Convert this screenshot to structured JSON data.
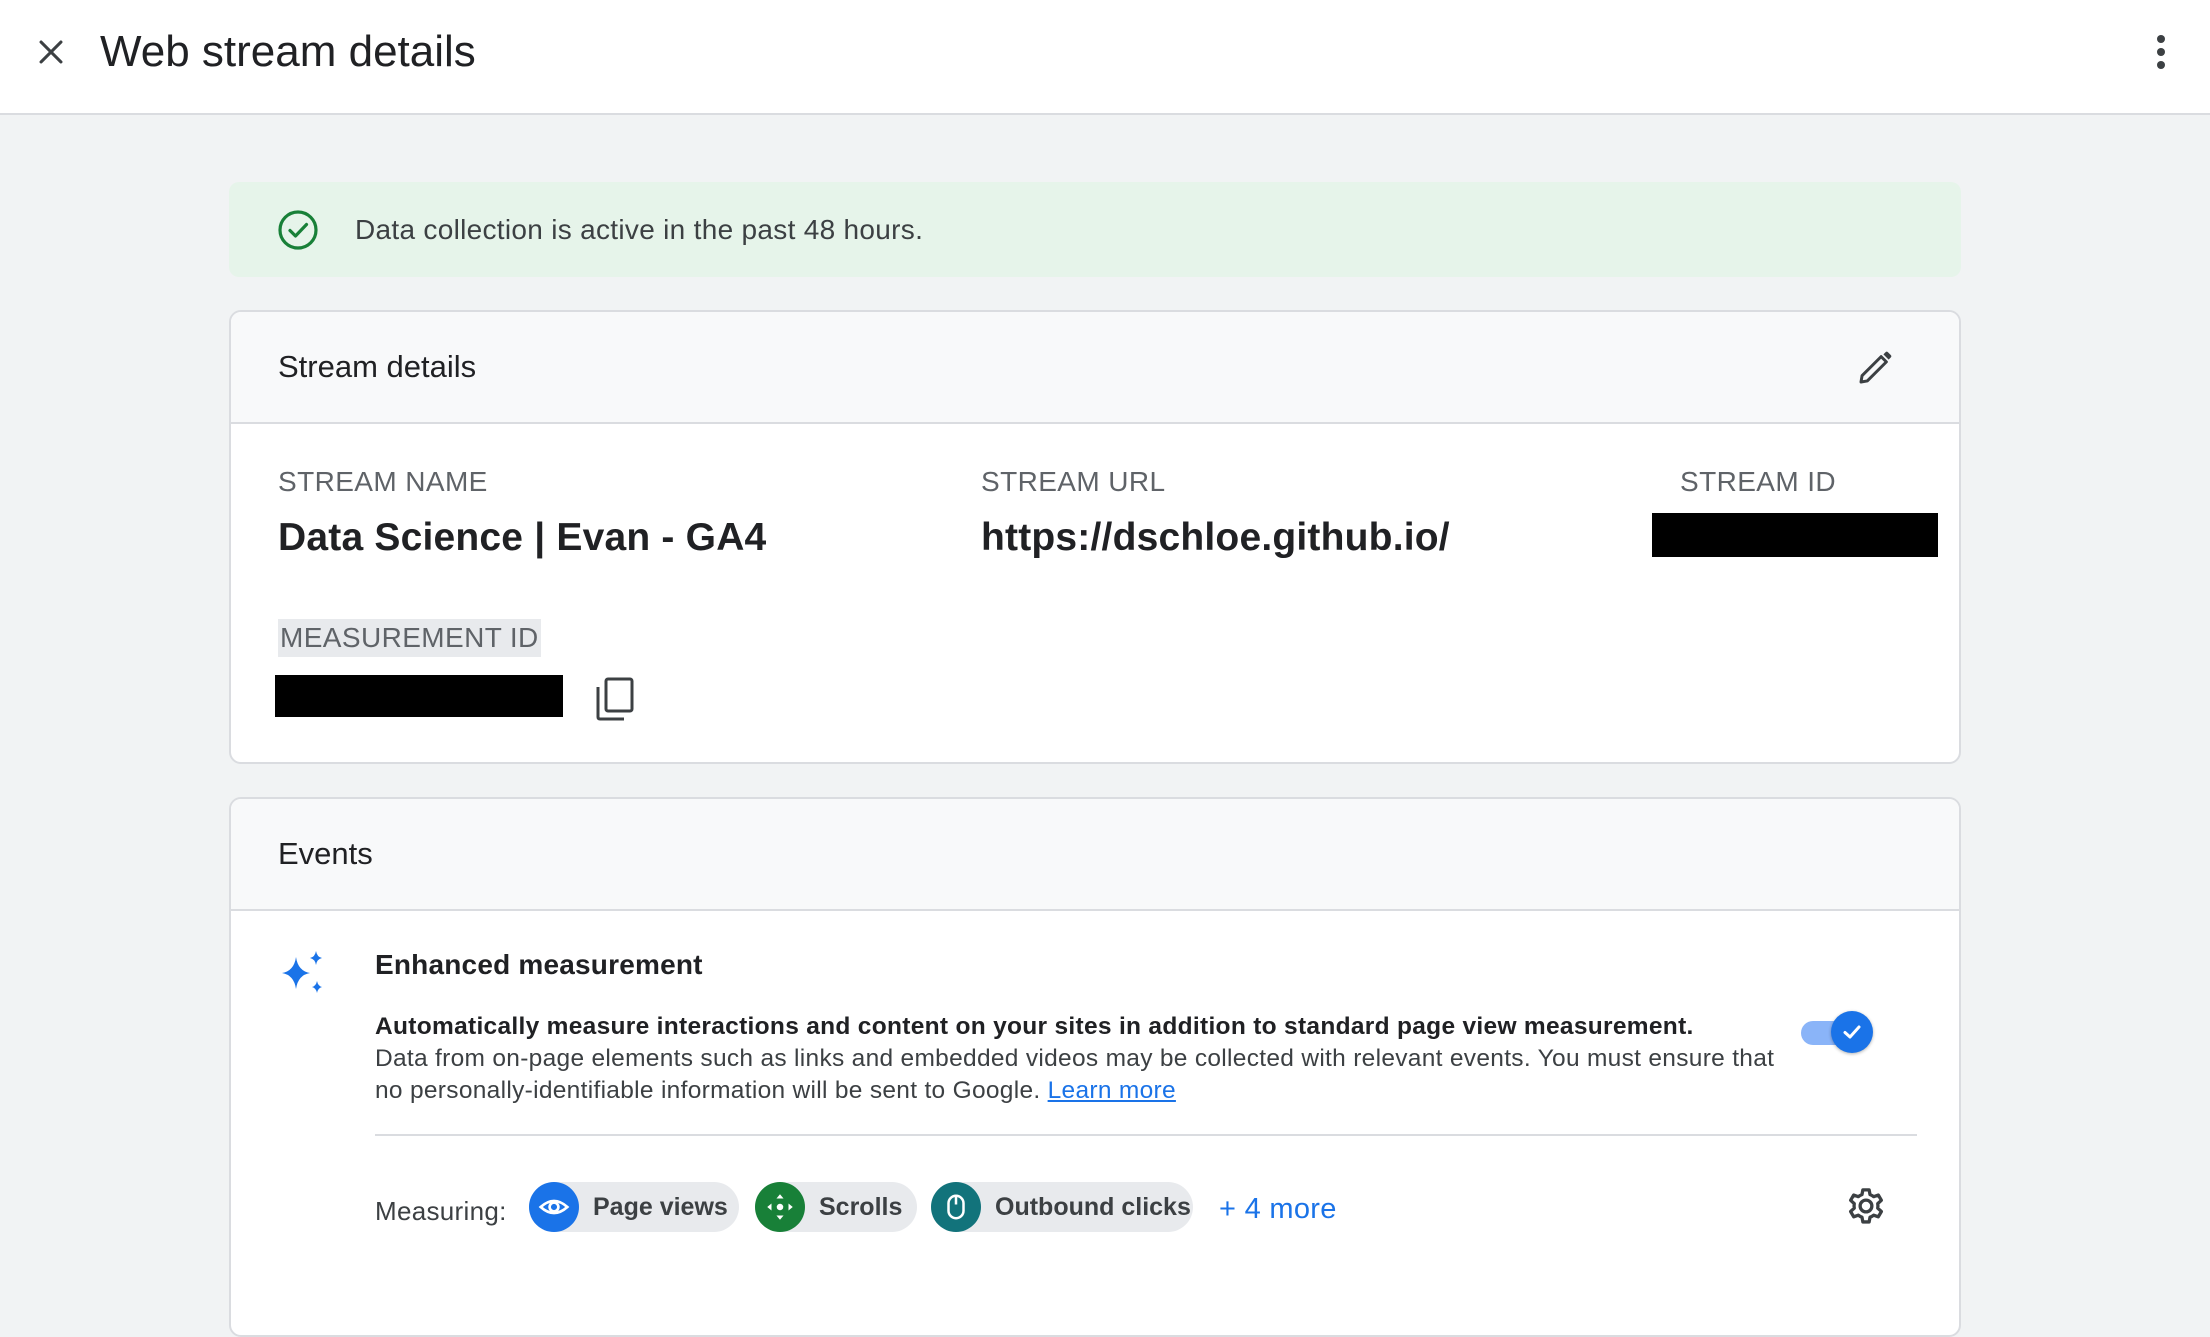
{
  "header": {
    "title": "Web stream details",
    "close_icon": "close-icon",
    "more_icon": "more-vert-icon"
  },
  "status_banner": {
    "text": "Data collection is active in the past 48 hours.",
    "icon": "check-circle-icon",
    "color": "#188038"
  },
  "stream_details": {
    "heading": "Stream details",
    "edit_icon": "pencil-icon",
    "stream_name_label": "STREAM NAME",
    "stream_name_value": "Data Science | Evan - GA4",
    "stream_url_label": "STREAM URL",
    "stream_url_value": "https://dschloe.github.io/",
    "stream_id_label": "STREAM ID",
    "measurement_id_label": "MEASUREMENT ID",
    "copy_icon": "copy-icon"
  },
  "events": {
    "heading": "Events",
    "enhanced": {
      "icon": "sparkle-icon",
      "title": "Enhanced measurement",
      "desc_strong": "Automatically measure interactions and content on your sites in addition to standard page view measurement.",
      "desc_rest": "Data from on-page elements such as links and embedded videos may be collected with relevant events. You must ensure that no personally-identifiable information will be sent to Google.",
      "learn_more": "Learn more",
      "toggle_on": true
    },
    "measuring_label": "Measuring:",
    "chips": [
      {
        "label": "Page views",
        "icon": "eye-icon",
        "color": "#1a73e8"
      },
      {
        "label": "Scrolls",
        "icon": "scroll-arrows-icon",
        "color": "#188038"
      },
      {
        "label": "Outbound clicks",
        "icon": "mouse-icon",
        "color": "#12737b"
      }
    ],
    "more_link": "+ 4 more",
    "settings_icon": "gear-icon"
  },
  "colors": {
    "accent": "#1a73e8",
    "banner_bg": "#e6f4ea",
    "page_bg": "#f1f3f4"
  }
}
